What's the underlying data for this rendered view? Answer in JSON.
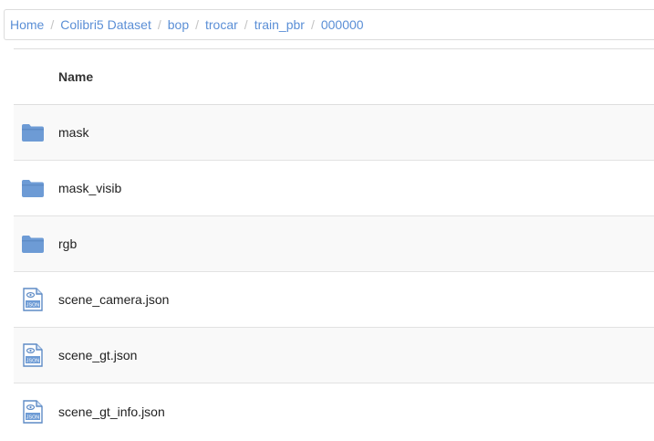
{
  "breadcrumb": [
    "Home",
    "Colibri5 Dataset",
    "bop",
    "trocar",
    "train_pbr",
    "000000"
  ],
  "breadcrumb_separator": "/",
  "table": {
    "header_name": "Name",
    "rows": [
      {
        "name": "mask",
        "icon": "folder-icon"
      },
      {
        "name": "mask_visib",
        "icon": "folder-icon"
      },
      {
        "name": "rgb",
        "icon": "folder-icon"
      },
      {
        "name": "scene_camera.json",
        "icon": "json-file-icon",
        "icon_label": "JSON"
      },
      {
        "name": "scene_gt.json",
        "icon": "json-file-icon",
        "icon_label": "JSON"
      },
      {
        "name": "scene_gt_info.json",
        "icon": "json-file-icon",
        "icon_label": "JSON"
      }
    ]
  },
  "colors": {
    "link": "#5b8fd6",
    "folder": "#6d9bd5",
    "row_stripe": "#f9f9f9"
  }
}
